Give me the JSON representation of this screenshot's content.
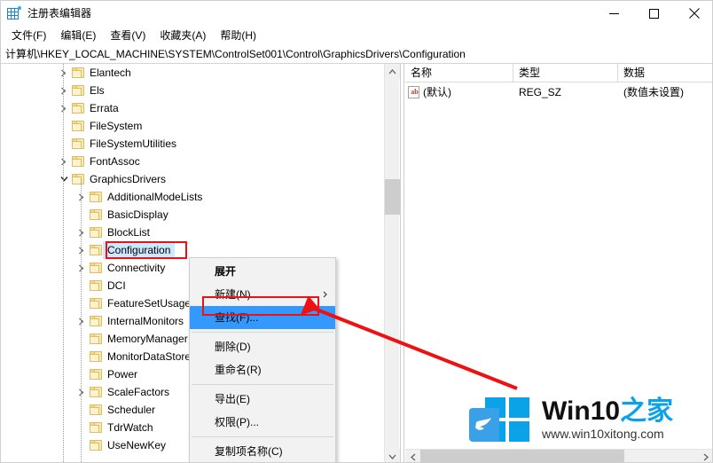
{
  "window": {
    "title": "注册表编辑器",
    "icon": "registry-icon",
    "controls": {
      "minimize": "minimize-icon",
      "maximize": "maximize-icon",
      "close": "close-icon"
    }
  },
  "menubar": {
    "items": [
      {
        "label": "文件(F)"
      },
      {
        "label": "编辑(E)"
      },
      {
        "label": "查看(V)"
      },
      {
        "label": "收藏夹(A)"
      },
      {
        "label": "帮助(H)"
      }
    ]
  },
  "address": {
    "path": "计算机\\HKEY_LOCAL_MACHINE\\SYSTEM\\ControlSet001\\Control\\GraphicsDrivers\\Configuration"
  },
  "tree": {
    "items": [
      {
        "label": "Elantech",
        "indent": 1,
        "chevron": "collapsed",
        "selected": false
      },
      {
        "label": "Els",
        "indent": 1,
        "chevron": "collapsed",
        "selected": false
      },
      {
        "label": "Errata",
        "indent": 1,
        "chevron": "collapsed",
        "selected": false
      },
      {
        "label": "FileSystem",
        "indent": 1,
        "chevron": "none",
        "selected": false
      },
      {
        "label": "FileSystemUtilities",
        "indent": 1,
        "chevron": "none",
        "selected": false
      },
      {
        "label": "FontAssoc",
        "indent": 1,
        "chevron": "collapsed",
        "selected": false
      },
      {
        "label": "GraphicsDrivers",
        "indent": 1,
        "chevron": "expanded",
        "selected": false
      },
      {
        "label": "AdditionalModeLists",
        "indent": 2,
        "chevron": "collapsed",
        "selected": false
      },
      {
        "label": "BasicDisplay",
        "indent": 2,
        "chevron": "none",
        "selected": false
      },
      {
        "label": "BlockList",
        "indent": 2,
        "chevron": "collapsed",
        "selected": false
      },
      {
        "label": "Configuration",
        "indent": 2,
        "chevron": "collapsed",
        "selected": true
      },
      {
        "label": "Connectivity",
        "indent": 2,
        "chevron": "collapsed",
        "selected": false
      },
      {
        "label": "DCI",
        "indent": 2,
        "chevron": "none",
        "selected": false
      },
      {
        "label": "FeatureSetUsage",
        "indent": 2,
        "chevron": "none",
        "selected": false
      },
      {
        "label": "InternalMonitors",
        "indent": 2,
        "chevron": "collapsed",
        "selected": false
      },
      {
        "label": "MemoryManager",
        "indent": 2,
        "chevron": "none",
        "selected": false
      },
      {
        "label": "MonitorDataStore",
        "indent": 2,
        "chevron": "none",
        "selected": false
      },
      {
        "label": "Power",
        "indent": 2,
        "chevron": "none",
        "selected": false
      },
      {
        "label": "ScaleFactors",
        "indent": 2,
        "chevron": "collapsed",
        "selected": false
      },
      {
        "label": "Scheduler",
        "indent": 2,
        "chevron": "none",
        "selected": false
      },
      {
        "label": "TdrWatch",
        "indent": 2,
        "chevron": "none",
        "selected": false
      },
      {
        "label": "UseNewKey",
        "indent": 2,
        "chevron": "none",
        "selected": false
      }
    ]
  },
  "list": {
    "columns": [
      {
        "label": "名称"
      },
      {
        "label": "类型"
      },
      {
        "label": "数据"
      }
    ],
    "rows": [
      {
        "icon": "string-value-icon",
        "name": "(默认)",
        "type": "REG_SZ",
        "data": "(数值未设置)"
      }
    ]
  },
  "context_menu": {
    "items": [
      {
        "label": "展开",
        "bold": true,
        "highlighted": false,
        "submenu": false,
        "separator_after": false
      },
      {
        "label": "新建(N)",
        "bold": false,
        "highlighted": false,
        "submenu": true,
        "separator_after": false
      },
      {
        "label": "查找(F)...",
        "bold": false,
        "highlighted": true,
        "submenu": false,
        "separator_after": true
      },
      {
        "label": "删除(D)",
        "bold": false,
        "highlighted": false,
        "submenu": false,
        "separator_after": false
      },
      {
        "label": "重命名(R)",
        "bold": false,
        "highlighted": false,
        "submenu": false,
        "separator_after": true
      },
      {
        "label": "导出(E)",
        "bold": false,
        "highlighted": false,
        "submenu": false,
        "separator_after": false
      },
      {
        "label": "权限(P)...",
        "bold": false,
        "highlighted": false,
        "submenu": false,
        "separator_after": true
      },
      {
        "label": "复制项名称(C)",
        "bold": false,
        "highlighted": false,
        "submenu": false,
        "separator_after": false
      }
    ]
  },
  "annotations": {
    "color": "#ee1111",
    "boxes": [
      {
        "name": "configuration-key-highlight"
      },
      {
        "name": "find-menu-item-highlight"
      }
    ],
    "arrow": {
      "name": "pointer-arrow-to-find"
    }
  },
  "watermark": {
    "brand_main": "Win10",
    "brand_suffix": "之家",
    "url": "www.win10xitong.com"
  },
  "scrollbars": {
    "tree_vertical": "tree-vertical-scrollbar",
    "list_horizontal": "list-horizontal-scrollbar"
  }
}
